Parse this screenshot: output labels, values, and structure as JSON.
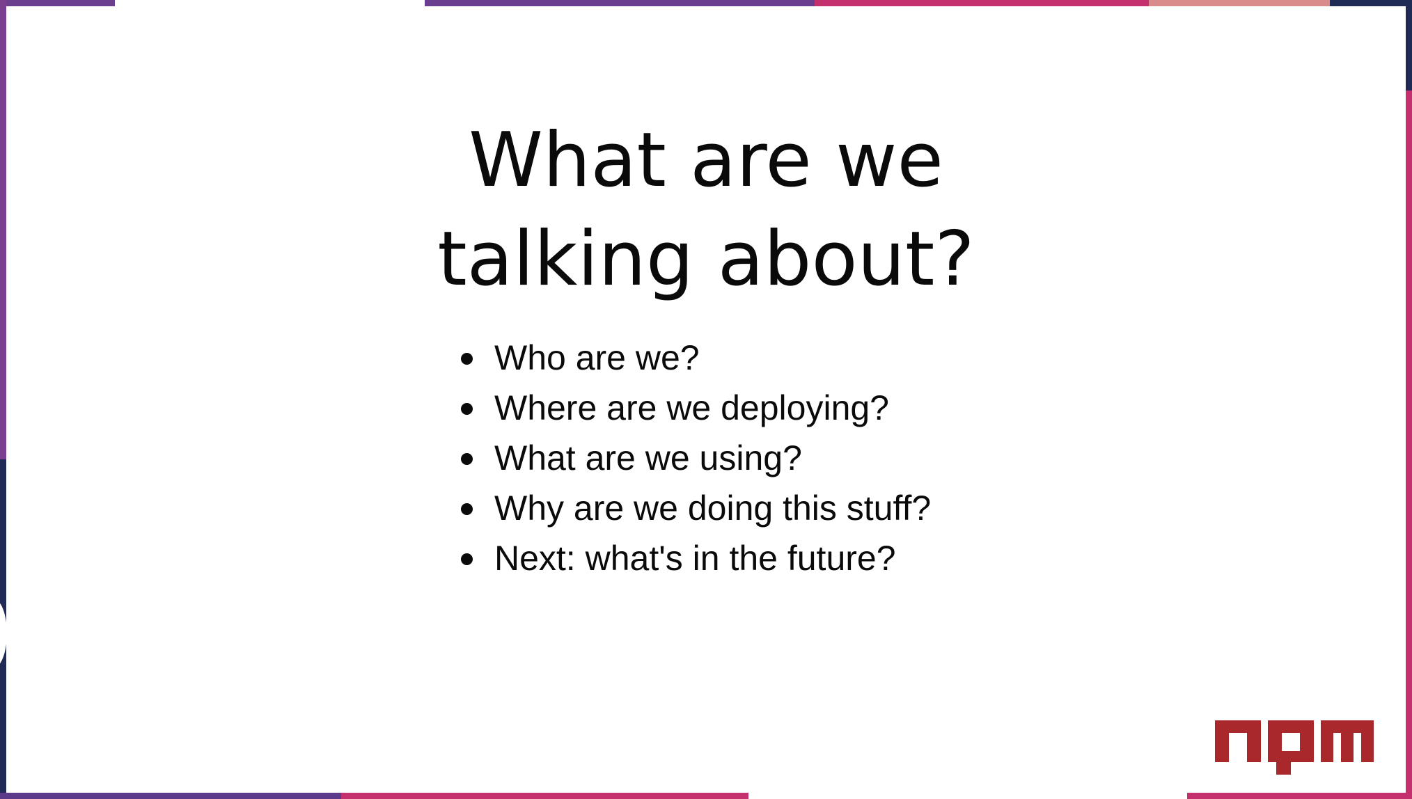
{
  "slide": {
    "title_line1": "What are we",
    "title_line2": "talking about?",
    "bullets": [
      "Who are we?",
      "Where are we deploying?",
      "What are we using?",
      "Why are we doing this stuff?",
      "Next: what's in the future?"
    ],
    "logo": {
      "icon": "npm-logo",
      "text": "npm",
      "color": "#a8282b"
    }
  },
  "colors": {
    "purple": "#6b3f8e",
    "magenta": "#c4306e",
    "navy": "#1f2b55",
    "peach": "#d98a8a"
  }
}
